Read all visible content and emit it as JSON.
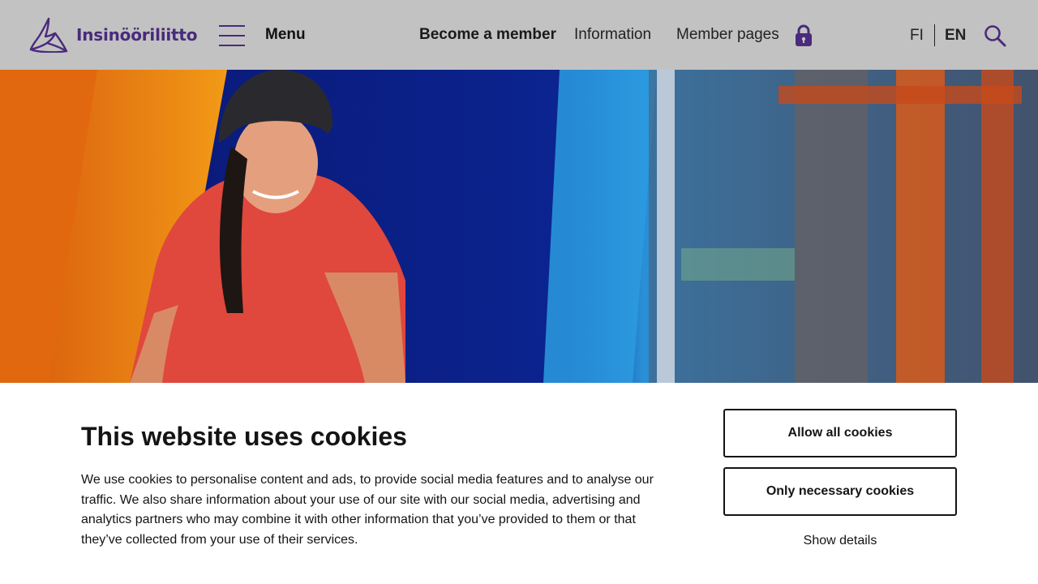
{
  "header": {
    "logo_text": "Insinööriliitto",
    "menu_label": "Menu",
    "nav": {
      "become_member": "Become a member",
      "information": "Information",
      "member_pages": "Member pages"
    },
    "lang": {
      "fi": "FI",
      "en": "EN"
    },
    "icons": {
      "logo": "insinooriliitto-logo-icon",
      "menu": "hamburger-menu-icon",
      "lock": "lock-icon",
      "search": "search-icon"
    },
    "colors": {
      "background": "#c2c2c2",
      "brand": "#4a2a7c"
    }
  },
  "cookie_banner": {
    "title": "This website uses cookies",
    "text": "We use cookies to personalise content and ads, to provide social media features and to analyse our traffic. We also share information about your use of our site with our social media, advertising and analytics partners who may combine it with other information that you’ve provided to them or that they’ve collected from your use of their services.",
    "allow_all_label": "Allow all cookies",
    "only_necessary_label": "Only necessary cookies",
    "show_details_label": "Show details"
  }
}
